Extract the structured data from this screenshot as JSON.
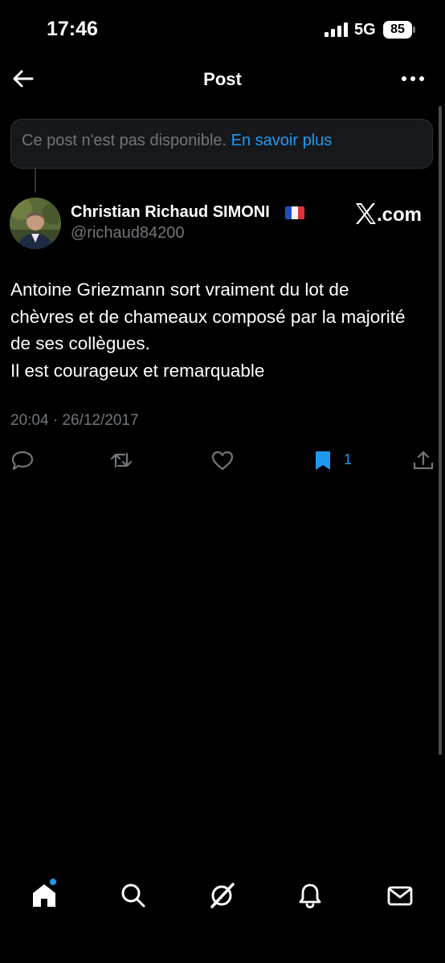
{
  "status_bar": {
    "time": "17:46",
    "network": "5G",
    "battery": "85"
  },
  "header": {
    "title": "Post"
  },
  "unavailable_notice": {
    "text": "Ce post n'est pas disponible.",
    "link": "En savoir plus"
  },
  "post": {
    "author_name": "Christian Richaud SIMONI",
    "author_handle": "@richaud84200",
    "source_label": "𝕏.com",
    "text_lines": [
      "Antoine Griezmann sort vraiment du lot de",
      "chèvres et de chameaux composé par la majorité",
      "de ses collègues.",
      "Il est courageux et remarquable"
    ],
    "date": "20:04 · 26/12/2017",
    "bookmark_count": "1"
  },
  "colors": {
    "accent": "#1d9bf0",
    "background": "#000000",
    "muted_text": "#71767b",
    "card_background": "#16181c"
  },
  "icons": {
    "back": "arrow-left-icon",
    "more": "more-horizontal-icon",
    "reply": "reply-icon",
    "retweet": "repost-icon",
    "like": "heart-icon",
    "bookmark": "bookmark-filled-icon",
    "share": "share-icon",
    "nav": [
      "home-icon",
      "search-icon",
      "grok-icon",
      "bell-icon",
      "mail-icon"
    ]
  }
}
